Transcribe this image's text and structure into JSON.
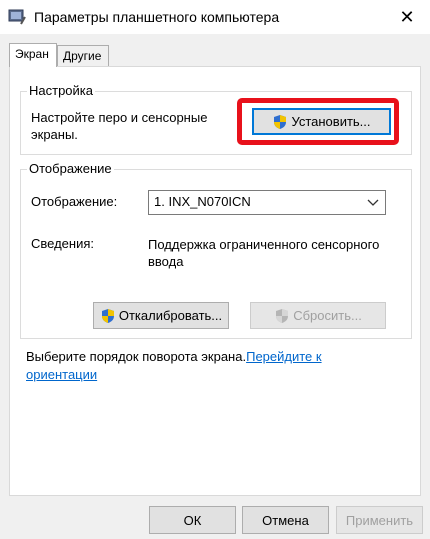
{
  "window": {
    "title": "Параметры планшетного компьютера",
    "close_glyph": "✕"
  },
  "tabs": [
    {
      "label": "Экран",
      "active": true
    },
    {
      "label": "Другие",
      "active": false
    }
  ],
  "setup_group": {
    "caption": "Настройка",
    "description_line1": "Настройте перо и сенсорные",
    "description_line2": "экраны.",
    "setup_button": "Установить..."
  },
  "display_group": {
    "caption": "Отображение",
    "display_label": "Отображение:",
    "display_value": "1. INX_N070ICN",
    "info_label": "Сведения:",
    "info_line1": "Поддержка ограниченного сенсорного",
    "info_line2": "ввода",
    "calibrate_button": "Откалибровать...",
    "reset_button": "Сбросить..."
  },
  "orientation": {
    "text": "Выберите порядок поворота экрана.",
    "link_part1": "Перейдите к",
    "link_part2": "ориентации"
  },
  "footer": {
    "ok": "ОК",
    "cancel": "Отмена",
    "apply": "Применить"
  },
  "colors": {
    "highlight": "#e8111b",
    "link": "#0066cc",
    "focus": "#0078d7"
  },
  "icons": {
    "app": "tablet-settings-icon",
    "shield": "uac-shield-icon",
    "close": "close-icon",
    "dropdown": "chevron-down-icon"
  }
}
